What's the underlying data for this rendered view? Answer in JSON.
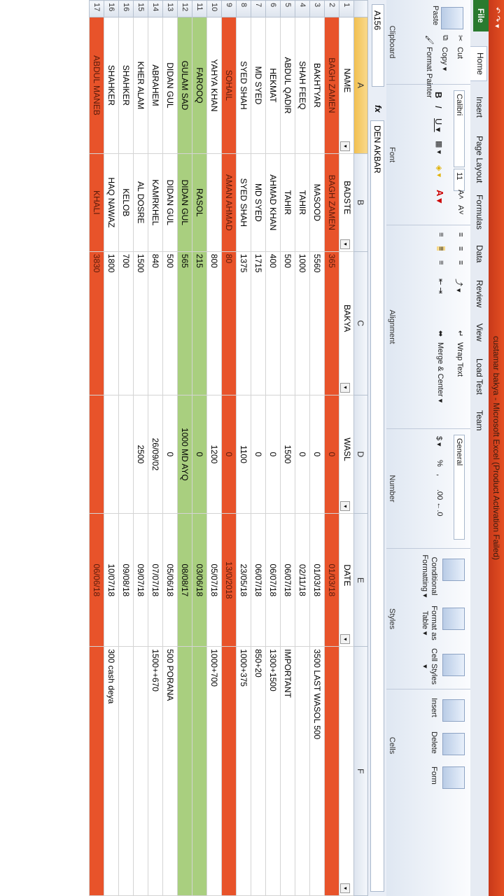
{
  "title_bar": {
    "quick_access": "↶ ↷ ▾",
    "title": "custamar bakya - Microsoft Excel (Product Activation Failed)"
  },
  "tabs": [
    {
      "label": "File"
    },
    {
      "label": "Home"
    },
    {
      "label": "Insert"
    },
    {
      "label": "Page Layout"
    },
    {
      "label": "Formulas"
    },
    {
      "label": "Data"
    },
    {
      "label": "Review"
    },
    {
      "label": "View"
    },
    {
      "label": "Load Test"
    },
    {
      "label": "Team"
    }
  ],
  "ribbon": {
    "clipboard": {
      "paste": "Paste",
      "cut": "Cut",
      "copy": "Copy ▾",
      "format_painter": "Format Painter",
      "label": "Clipboard"
    },
    "font": {
      "name": "Calibri",
      "size": "11",
      "grow": "A˄",
      "shrink": "A˅",
      "bold": "B",
      "italic": "I",
      "underline": "U ▾",
      "label": "Font"
    },
    "alignment": {
      "wrap_text": "Wrap Text",
      "merge_center": "Merge & Center ▾",
      "label": "Alignment"
    },
    "number": {
      "format": "General",
      "currency": "$ ▾",
      "percent": "%",
      "comma": ",",
      "inc_dec": ".00 ←.0",
      "label": "Number"
    },
    "styles": {
      "conditional": "Conditional Formatting ▾",
      "format_table": "Format as Table ▾",
      "cell_styles": "Cell Styles ▾",
      "label": "Styles"
    },
    "cells": {
      "insert": "Insert",
      "delete": "Delete",
      "format": "Form",
      "label": "Cells"
    }
  },
  "formula_bar": {
    "name_box": "A156",
    "fx": "fx",
    "content": "DEN AKBAR"
  },
  "columns": [
    "A",
    "B",
    "C",
    "D",
    "E",
    "F"
  ],
  "header_row": {
    "num": "1",
    "name": "NAME",
    "badste": "BADSTE",
    "bakya": "BAKYA",
    "wasl": "WASL",
    "date": "DATE",
    "f": ""
  },
  "rows": [
    {
      "num": "2",
      "style": "red",
      "name": "BAGH ZAMEN",
      "badste": "BAGH ZAMEN",
      "bakya": "365",
      "wasl": "0",
      "date": "01/03/18",
      "f": ""
    },
    {
      "num": "3",
      "style": "",
      "name": "BAKHTYAR",
      "badste": "MASOOD",
      "bakya": "5560",
      "wasl": "0",
      "date": "01/03/18",
      "f": "3500 LAST WASOL   500"
    },
    {
      "num": "4",
      "style": "",
      "name": "SHAH FEEQ",
      "badste": "TAHIR",
      "bakya": "1000",
      "wasl": "0",
      "date": "02/11/18",
      "f": ""
    },
    {
      "num": "5",
      "style": "",
      "name": "ABDUL QADIR",
      "badste": "TAHIR",
      "bakya": "500",
      "wasl": "1500",
      "date": "06/07/18",
      "f": "IMPORTANT"
    },
    {
      "num": "6",
      "style": "",
      "name": "HEKMAT",
      "badste": "AHMAD KHAN",
      "bakya": "400",
      "wasl": "0",
      "date": "06/07/18",
      "f": "1300+1500"
    },
    {
      "num": "7",
      "style": "",
      "name": "MD SYED",
      "badste": "MD SYED",
      "bakya": "1715",
      "wasl": "0",
      "date": "06/07/18",
      "f": "850+20"
    },
    {
      "num": "8",
      "style": "",
      "name": "SYED SHAH",
      "badste": "SYED SHAH",
      "bakya": "1375",
      "wasl": "1100",
      "date": "23/05/18",
      "f": "1000+375"
    },
    {
      "num": "9",
      "style": "red",
      "name": "SOHAIL",
      "badste": "AMAN AHMAD",
      "bakya": "80",
      "wasl": "0",
      "date": "13/0/2018",
      "f": ""
    },
    {
      "num": "10",
      "style": "",
      "name": "YAHYA KHAN",
      "badste": "",
      "bakya": "800",
      "wasl": "1200",
      "date": "05/07/18",
      "f": "1000+700"
    },
    {
      "num": "11",
      "style": "green",
      "name": "FAROOQ",
      "badste": "RASOL",
      "bakya": "215",
      "wasl": "0",
      "date": "03/06/18",
      "f": ""
    },
    {
      "num": "12",
      "style": "green",
      "name": "GULAM SAD",
      "badste": "DIDAN GUL",
      "bakya": "565",
      "wasl": "1000 MD AYQ",
      "date": "08/08/17",
      "f": ""
    },
    {
      "num": "13",
      "style": "",
      "name": "DIDAN GUL",
      "badste": "DIDAN GUL",
      "bakya": "500",
      "wasl": "0",
      "date": "05/06/18",
      "f": "500 PORANA"
    },
    {
      "num": "14",
      "style": "",
      "name": "ABRAHEM",
      "badste": "KAMRKHEL",
      "bakya": "840",
      "wasl": "26/09/02",
      "date": "07/07/18",
      "f": "1500++670"
    },
    {
      "num": "15",
      "style": "",
      "name": "KHER ALAM",
      "badste": "AL DOSRE",
      "bakya": "1500",
      "wasl": "2500",
      "date": "09/07/18",
      "f": ""
    },
    {
      "num": "16",
      "style": "",
      "name": "SHAHKER",
      "badste": "KELOB",
      "bakya": "700",
      "wasl": "",
      "date": "09/08/18",
      "f": ""
    },
    {
      "num": "16",
      "style": "",
      "name": "SHAHKER",
      "badste": "HAQ NAWAZ",
      "bakya": "1800",
      "wasl": "",
      "date": "10/07/18",
      "f": "300 cash deya"
    },
    {
      "num": "17",
      "style": "red",
      "name": "ABDUL MANEB",
      "badste": "KHALI",
      "bakya": "3830",
      "wasl": "",
      "date": "06/06/18",
      "f": ""
    }
  ],
  "colors": {
    "red_row": "#e8532a",
    "green_row": "#a9cf7f",
    "title_bar": "#d9441c",
    "file_tab": "#2a7a2f"
  }
}
